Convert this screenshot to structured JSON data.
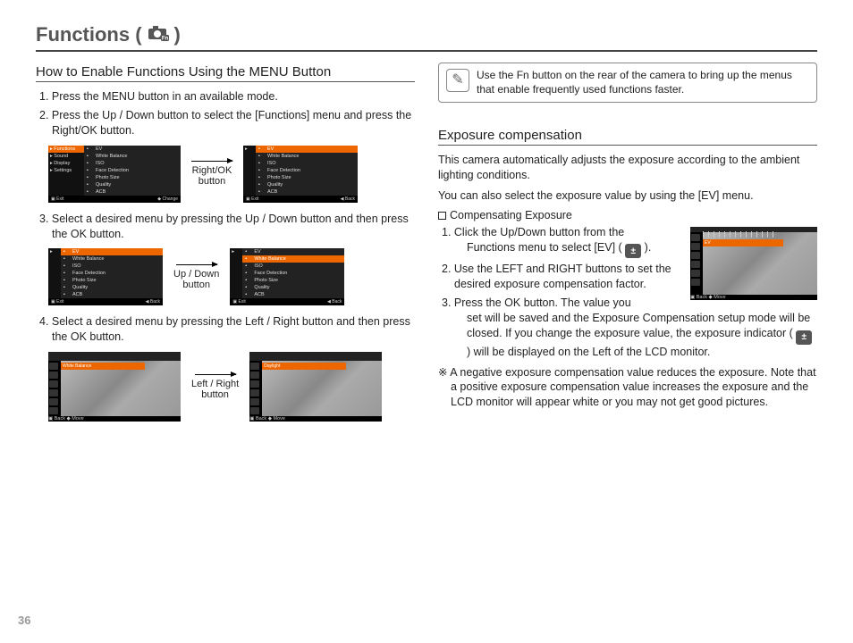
{
  "page_number": "36",
  "title_prefix": "Functions (",
  "title_suffix": " )",
  "left": {
    "heading": "How to Enable Functions Using the MENU Button",
    "step1": "1. Press the MENU button in an available mode.",
    "step2": "2. Press the Up / Down button to select the [Functions] menu and press the Right/OK button.",
    "row1_label_line1": "Right/OK",
    "row1_label_line2": "button",
    "step3": "3. Select a desired menu by pressing the Up / Down button and then press the OK button.",
    "row2_label_line1": "Up / Down",
    "row2_label_line2": "button",
    "step4": "4. Select a desired menu by pressing the Left / Right button and then press the OK button.",
    "row3_label_line1": "Left / Right",
    "row3_label_line2": "button",
    "shot1_sidebar": [
      "Functions",
      "Sound",
      "Display",
      "Settings"
    ],
    "shot1_list": [
      "EV",
      "White Balance",
      "ISO",
      "Face Detection",
      "Photo Size",
      "Quality",
      "ACB"
    ],
    "shot1_foot_left": "Exit",
    "shot1_foot_right": "Change",
    "shot2_list": [
      "EV",
      "White Balance",
      "ISO",
      "Face Detection",
      "Photo Size",
      "Quality",
      "ACB"
    ],
    "shot2_foot_left": "Exit",
    "shot2_foot_right": "Back",
    "shot3_list": [
      "EV",
      "White Balance",
      "ISO",
      "Face Detection",
      "Photo Size",
      "Quality",
      "ACB"
    ],
    "shot3_foot_left": "Exit",
    "shot3_foot_right": "Back",
    "shot3_sel_index": 0,
    "shot4_list": [
      "EV",
      "White Balance",
      "ISO",
      "Face Detection",
      "Photo Size",
      "Quality",
      "ACB"
    ],
    "shot4_foot_left": "Exit",
    "shot4_foot_right": "Back",
    "shot4_sel_index": 1,
    "pshot1_banner": "White Balance",
    "pshot1_foot_left": "Back",
    "pshot1_foot_right": "Move",
    "pshot2_banner": "Daylight",
    "pshot2_foot_left": "Back",
    "pshot2_foot_right": "Move"
  },
  "right": {
    "note_text": "Use the Fn button on the rear of the camera to bring up the menus that enable frequently used functions faster.",
    "heading": "Exposure compensation",
    "para1": "This camera automatically adjusts the exposure according to the ambient lighting conditions.",
    "para2": "You can also select the exposure value by using the [EV] menu.",
    "comp_title": "Compensating Exposure",
    "step1a": "1. Click the Up/Down button from the",
    "step1b": "Functions menu to select [EV] (",
    "step1c": ").",
    "step2": "2. Use the LEFT and RIGHT buttons to set the desired exposure compensation factor.",
    "step3a": "3. Press the OK button. The value you",
    "step3b": "set will be saved and the Exposure Compensation setup mode will be closed. If you change the exposure value, the exposure indicator (",
    "step3c": " ) will be displayed on the Left of the LCD monitor.",
    "neg_note": "※ A negative exposure compensation value reduces the exposure. Note that a positive exposure compensation value increases the exposure and the LCD monitor will appear white or you may not get good pictures.",
    "ev_banner": "EV",
    "ev_foot_left": "Back",
    "ev_foot_right": "Move"
  }
}
